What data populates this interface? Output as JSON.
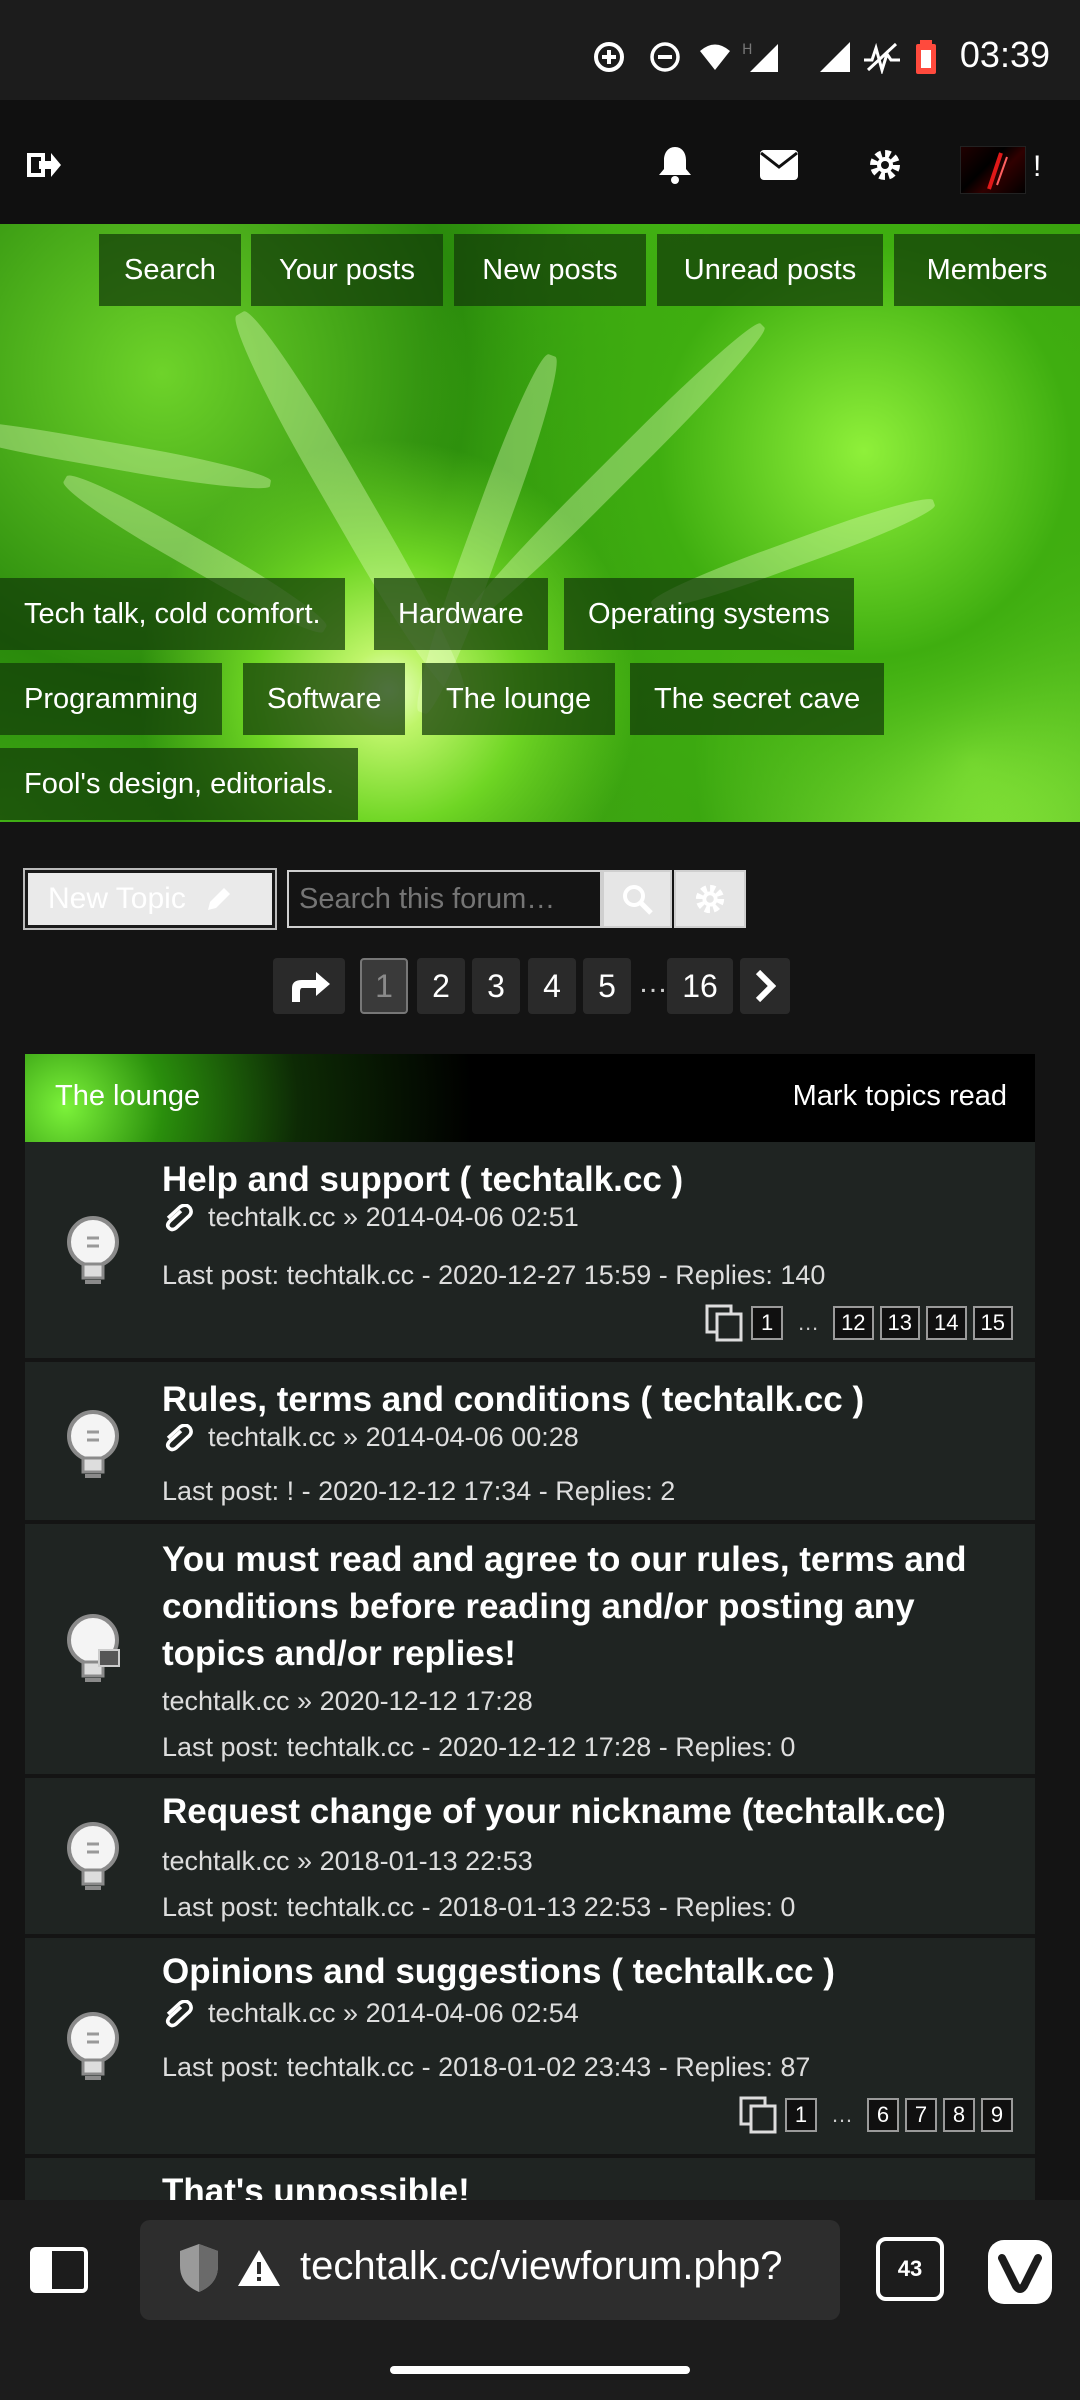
{
  "status_bar": {
    "time": "03:39"
  },
  "header": {
    "user_mark": "!"
  },
  "nav": [
    "Search",
    "Your posts",
    "New posts",
    "Unread posts",
    "Members"
  ],
  "categories": [
    "Tech talk, cold comfort.",
    "Hardware",
    "Operating systems",
    "Programming",
    "Software",
    "The lounge",
    "The secret cave",
    "Fool's design, editorials."
  ],
  "toolbar": {
    "new_topic_label": "New Topic",
    "search_placeholder": "Search this forum…"
  },
  "pagination": {
    "pages": [
      "1",
      "2",
      "3",
      "4",
      "5",
      "16"
    ],
    "ellipsis": "…",
    "current": "1"
  },
  "forum": {
    "title": "The lounge",
    "mark_read": "Mark topics read"
  },
  "topics": [
    {
      "title": "Help and support ( techtalk.cc )",
      "meta": "techtalk.cc » 2014-04-06 02:51",
      "last": "Last post: techtalk.cc - 2020-12-27 15:59 - Replies: 140",
      "pages": [
        "1",
        "12",
        "13",
        "14",
        "15"
      ]
    },
    {
      "title": "Rules, terms and conditions ( techtalk.cc )",
      "meta": "techtalk.cc » 2014-04-06 00:28",
      "last": "Last post: ! - 2020-12-12 17:34 - Replies: 2"
    },
    {
      "title": "You must read and agree to our rules, terms and conditions before reading and/or posting any topics and/or replies!",
      "meta": "techtalk.cc » 2020-12-12 17:28",
      "last": "Last post: techtalk.cc - 2020-12-12 17:28 - Replies: 0"
    },
    {
      "title": "Request change of your nickname (techtalk.cc)",
      "meta": "techtalk.cc » 2018-01-13 22:53",
      "last": "Last post: techtalk.cc - 2018-01-13 22:53 - Replies: 0"
    },
    {
      "title": "Opinions and suggestions ( techtalk.cc )",
      "meta": "techtalk.cc » 2014-04-06 02:54",
      "last": "Last post: techtalk.cc - 2018-01-02 23:43 - Replies: 87",
      "pages": [
        "1",
        "6",
        "7",
        "8",
        "9"
      ]
    },
    {
      "title": "That's unpossible!"
    }
  ],
  "browser": {
    "url": "techtalk.cc/viewforum.php?",
    "tab_count": "43"
  }
}
